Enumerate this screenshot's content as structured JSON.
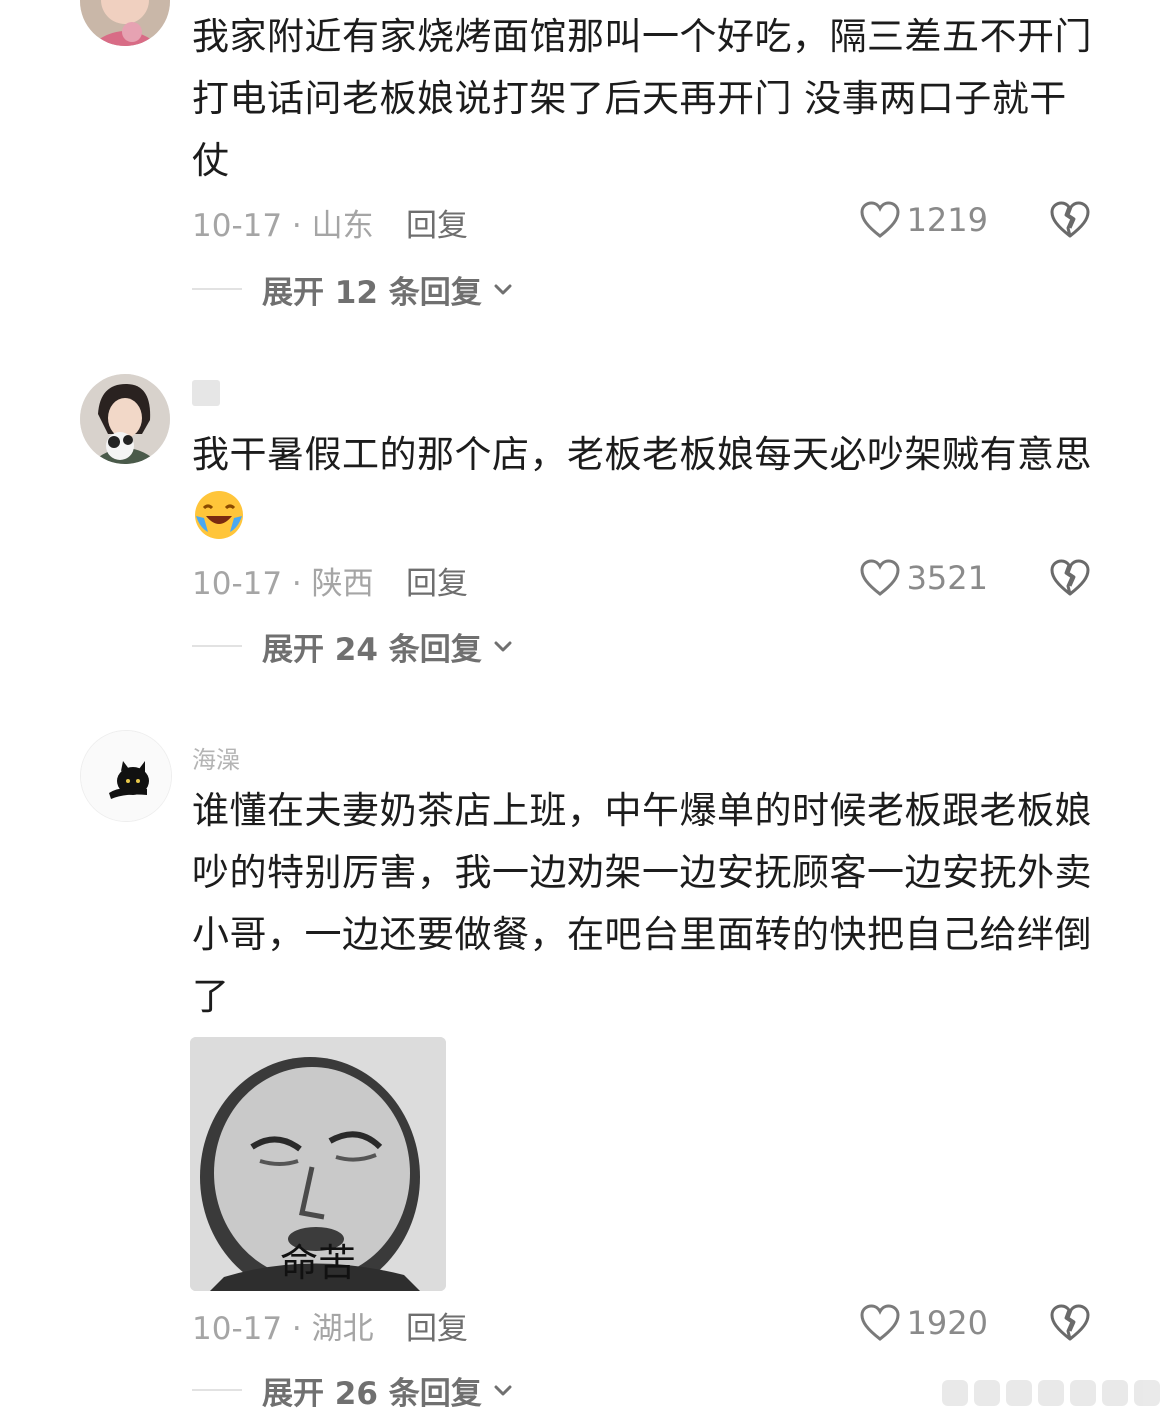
{
  "comments": [
    {
      "text": "我家附近有家烧烤面馆那叫一个好吃，隔三差五不开门\n打电话问老板娘说打架了后天再开门 没事两口子就干\n仗",
      "date_location": "10-17 · 山东",
      "reply_label": "回复",
      "likes": "1219",
      "expand_label": "展开 12 条回复"
    },
    {
      "username": "",
      "text": "我干暑假工的那个店，老板老板娘每天必吵架贼有意思",
      "emoji": "crying-laughing-emoji",
      "date_location": "10-17 · 陕西",
      "reply_label": "回复",
      "likes": "3521",
      "expand_label": "展开 24 条回复"
    },
    {
      "username": "海澡",
      "text": "谁懂在夫妻奶茶店上班，中午爆单的时候老板跟老板娘\n吵的特别厉害，我一边劝架一边安抚顾客一边安抚外卖\n小哥，一边还要做餐，在吧台里面转的快把自己给绊倒\n了",
      "sticker_caption": "命苦",
      "date_location": "10-17 · 湖北",
      "reply_label": "回复",
      "likes": "1920",
      "expand_label": "展开 26 条回复"
    }
  ],
  "icons": {
    "like": "heart-outline-icon",
    "dislike": "broken-heart-icon",
    "expand": "chevron-down-icon"
  },
  "colors": {
    "text": "#1c1c1c",
    "meta": "#a5a5a5",
    "reply": "#6e6e6e"
  }
}
